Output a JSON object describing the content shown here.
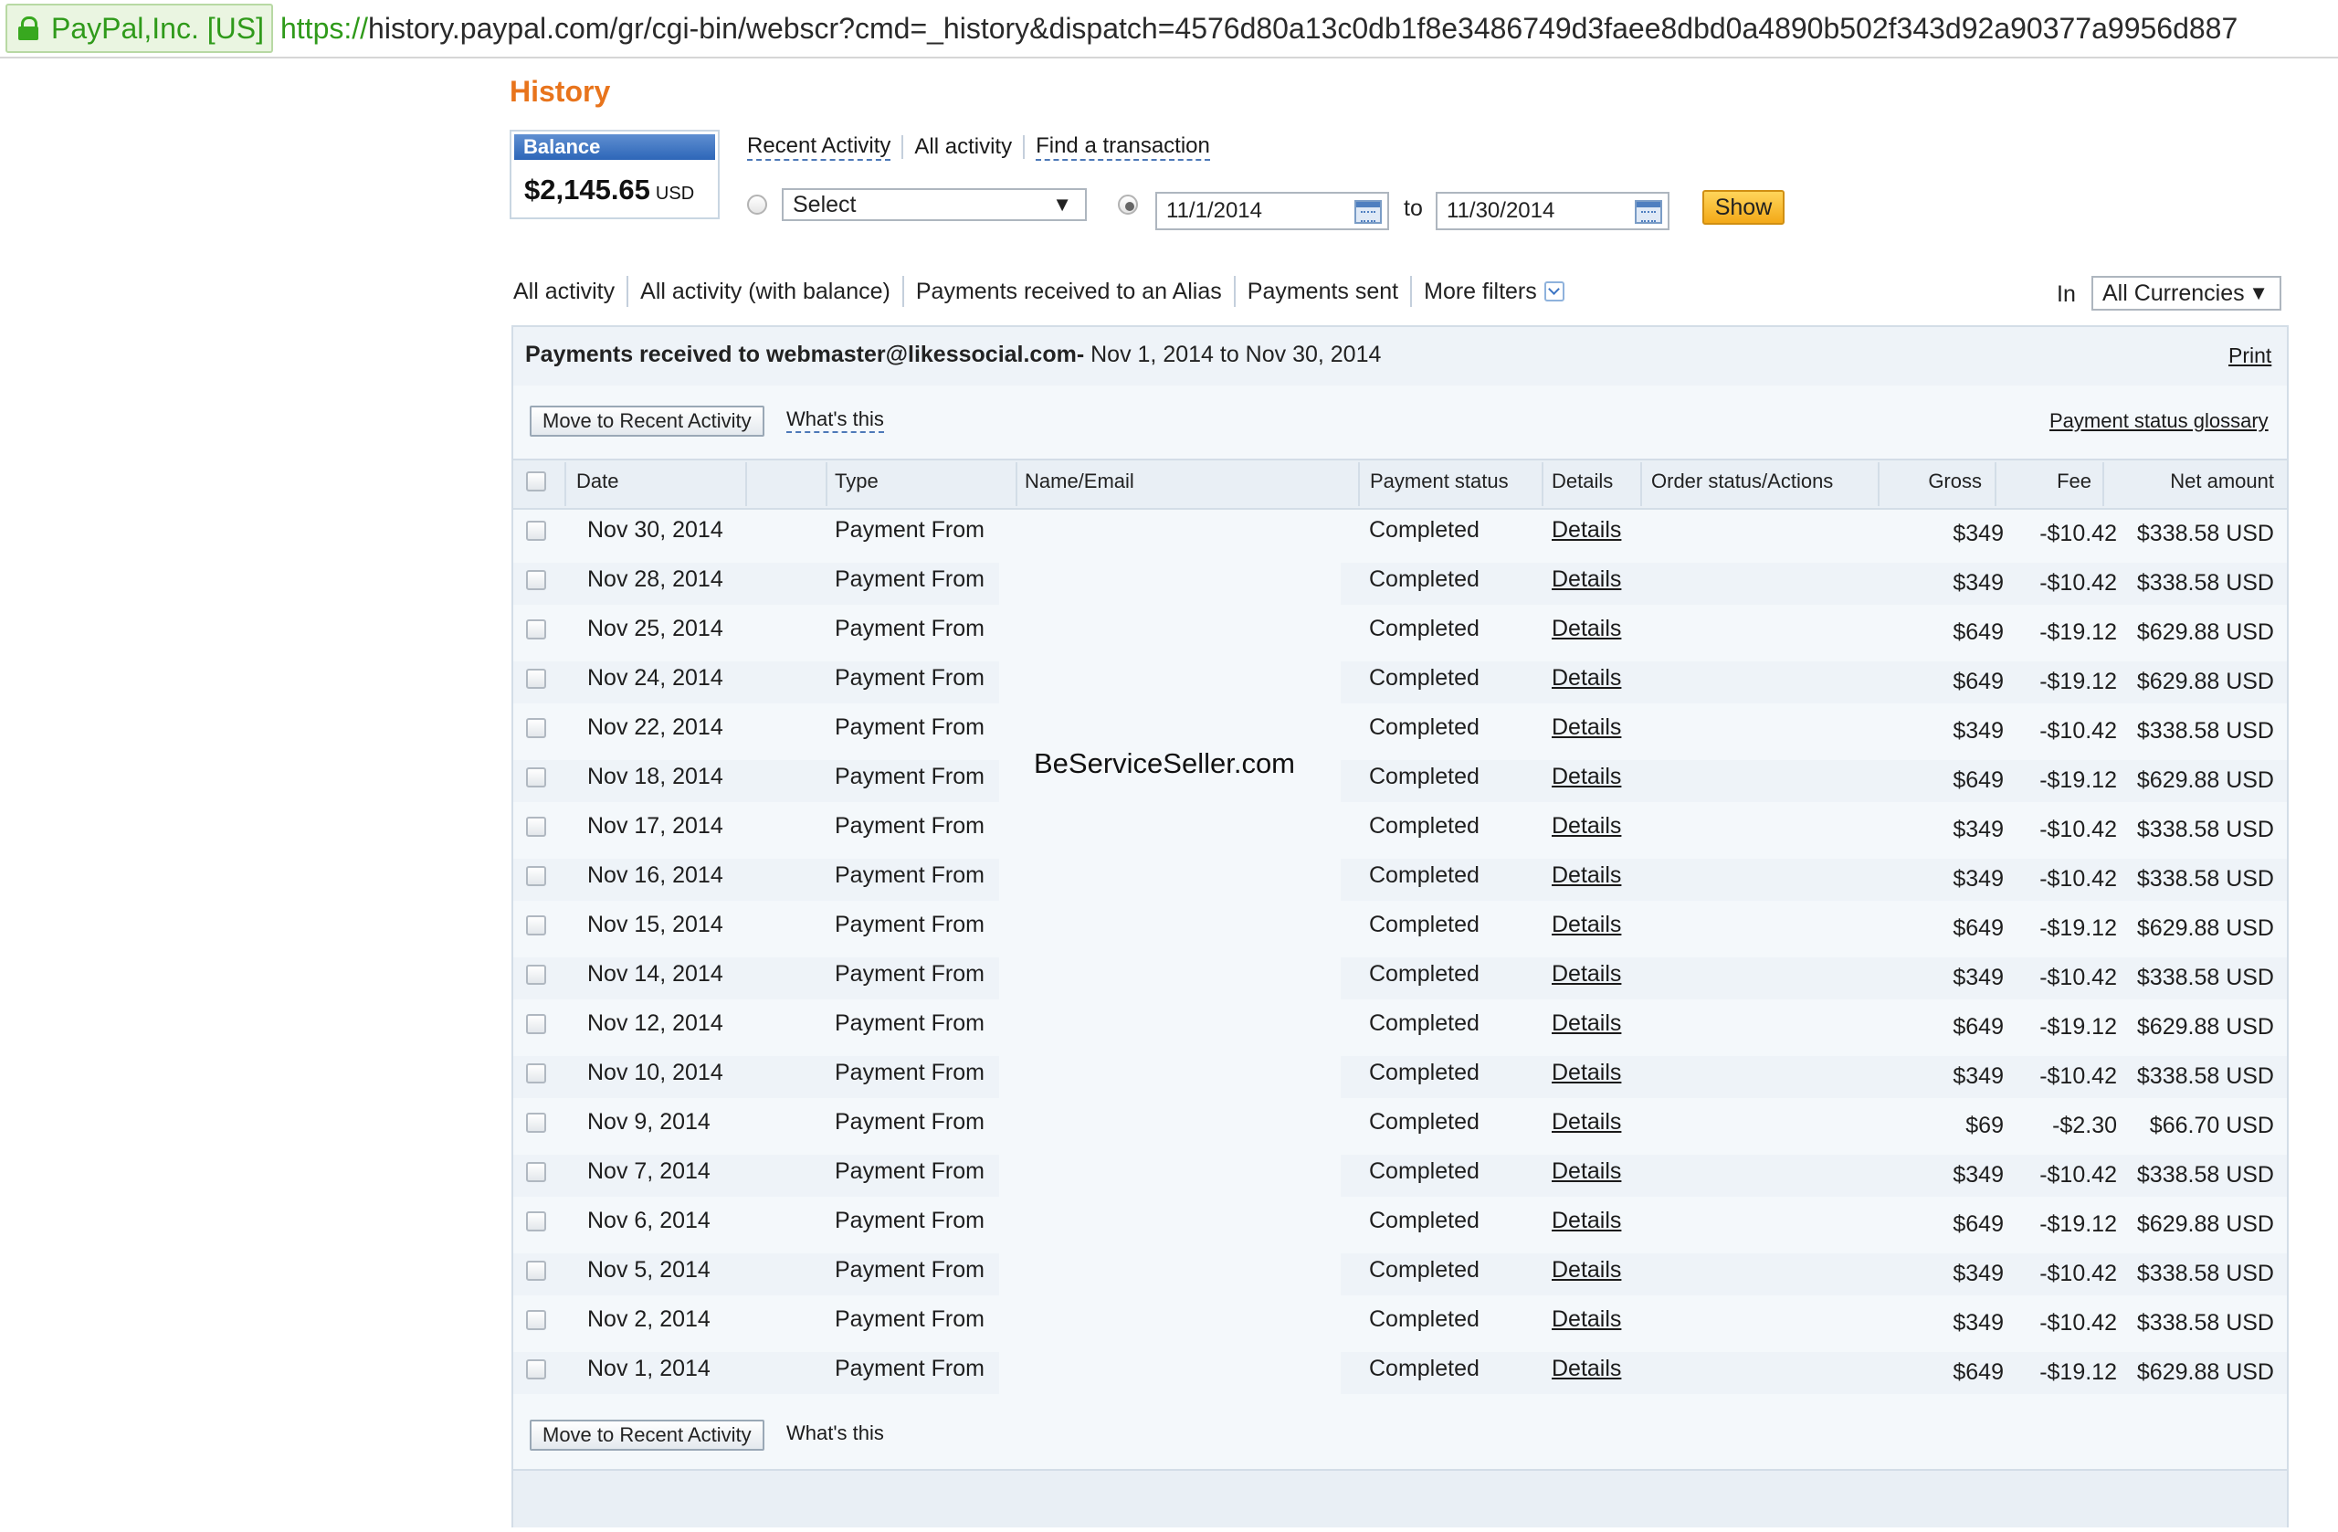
{
  "browser": {
    "ev_label": "PayPal,Inc. [US]",
    "url_scheme": "https://",
    "url_rest": "history.paypal.com/gr/cgi-bin/webscr?cmd=_history&dispatch=4576d80a13c0db1f8e3486749d3faee8dbd0a4890b502f343d92a90377a9956d887"
  },
  "page": {
    "title": "History"
  },
  "balance": {
    "label": "Balance",
    "amount": "$2,145.65",
    "currency": "USD"
  },
  "top_links": [
    "Recent Activity",
    "All activity",
    "Find a transaction"
  ],
  "filter": {
    "select_value": "Select",
    "date_from": "11/1/2014",
    "to_label": "to",
    "date_to": "11/30/2014",
    "show_label": "Show"
  },
  "tabs": [
    "All activity",
    "All activity (with balance)",
    "Payments received to an Alias",
    "Payments sent",
    "More filters"
  ],
  "currency": {
    "in_label": "In",
    "value": "All Currencies"
  },
  "panel": {
    "title_bold": "Payments received to webmaster@likessocial.com-",
    "title_range": " Nov 1, 2014 to Nov 30, 2014",
    "print_label": "Print",
    "move_label": "Move to Recent Activity",
    "whats_this": "What's this",
    "glossary_label": "Payment status glossary"
  },
  "columns": [
    "Date",
    "Type",
    "Name/Email",
    "Payment status",
    "Details",
    "Order status/Actions",
    "Gross",
    "Fee",
    "Net amount"
  ],
  "watermark": "BeServiceSeller.com",
  "rows": [
    {
      "date": "Nov 30, 2014",
      "type": "Payment From",
      "status": "Completed",
      "details": "Details",
      "gross": "$349",
      "fee": "-$10.42",
      "net": "$338.58 USD"
    },
    {
      "date": "Nov 28, 2014",
      "type": "Payment From",
      "status": "Completed",
      "details": "Details",
      "gross": "$349",
      "fee": "-$10.42",
      "net": "$338.58 USD"
    },
    {
      "date": "Nov 25, 2014",
      "type": "Payment From",
      "status": "Completed",
      "details": "Details",
      "gross": "$649",
      "fee": "-$19.12",
      "net": "$629.88 USD"
    },
    {
      "date": "Nov 24, 2014",
      "type": "Payment From",
      "status": "Completed",
      "details": "Details",
      "gross": "$649",
      "fee": "-$19.12",
      "net": "$629.88 USD"
    },
    {
      "date": "Nov 22, 2014",
      "type": "Payment From",
      "status": "Completed",
      "details": "Details",
      "gross": "$349",
      "fee": "-$10.42",
      "net": "$338.58 USD"
    },
    {
      "date": "Nov 18, 2014",
      "type": "Payment From",
      "status": "Completed",
      "details": "Details",
      "gross": "$649",
      "fee": "-$19.12",
      "net": "$629.88 USD"
    },
    {
      "date": "Nov 17, 2014",
      "type": "Payment From",
      "status": "Completed",
      "details": "Details",
      "gross": "$349",
      "fee": "-$10.42",
      "net": "$338.58 USD"
    },
    {
      "date": "Nov 16, 2014",
      "type": "Payment From",
      "status": "Completed",
      "details": "Details",
      "gross": "$349",
      "fee": "-$10.42",
      "net": "$338.58 USD"
    },
    {
      "date": "Nov 15, 2014",
      "type": "Payment From",
      "status": "Completed",
      "details": "Details",
      "gross": "$649",
      "fee": "-$19.12",
      "net": "$629.88 USD"
    },
    {
      "date": "Nov 14, 2014",
      "type": "Payment From",
      "status": "Completed",
      "details": "Details",
      "gross": "$349",
      "fee": "-$10.42",
      "net": "$338.58 USD"
    },
    {
      "date": "Nov 12, 2014",
      "type": "Payment From",
      "status": "Completed",
      "details": "Details",
      "gross": "$649",
      "fee": "-$19.12",
      "net": "$629.88 USD"
    },
    {
      "date": "Nov 10, 2014",
      "type": "Payment From",
      "status": "Completed",
      "details": "Details",
      "gross": "$349",
      "fee": "-$10.42",
      "net": "$338.58 USD"
    },
    {
      "date": "Nov 9, 2014",
      "type": "Payment From",
      "status": "Completed",
      "details": "Details",
      "gross": "$69",
      "fee": "-$2.30",
      "net": "$66.70 USD"
    },
    {
      "date": "Nov 7, 2014",
      "type": "Payment From",
      "status": "Completed",
      "details": "Details",
      "gross": "$349",
      "fee": "-$10.42",
      "net": "$338.58 USD"
    },
    {
      "date": "Nov 6, 2014",
      "type": "Payment From",
      "status": "Completed",
      "details": "Details",
      "gross": "$649",
      "fee": "-$19.12",
      "net": "$629.88 USD"
    },
    {
      "date": "Nov 5, 2014",
      "type": "Payment From",
      "status": "Completed",
      "details": "Details",
      "gross": "$349",
      "fee": "-$10.42",
      "net": "$338.58 USD"
    },
    {
      "date": "Nov 2, 2014",
      "type": "Payment From",
      "status": "Completed",
      "details": "Details",
      "gross": "$349",
      "fee": "-$10.42",
      "net": "$338.58 USD"
    },
    {
      "date": "Nov 1, 2014",
      "type": "Payment From",
      "status": "Completed",
      "details": "Details",
      "gross": "$649",
      "fee": "-$19.12",
      "net": "$629.88 USD"
    }
  ]
}
